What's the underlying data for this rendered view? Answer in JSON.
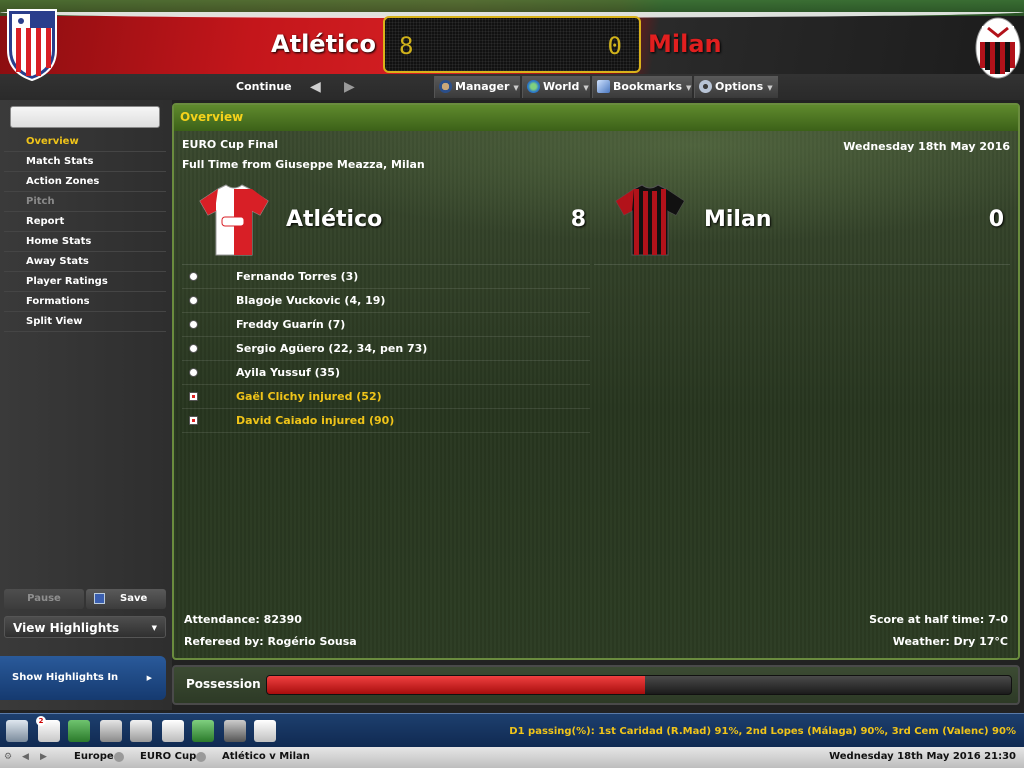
{
  "header": {
    "home_team": "Atlético",
    "away_team": "Milan",
    "scoreboard_home": "8",
    "scoreboard_away": "0"
  },
  "nav": {
    "continue": "Continue",
    "menus": [
      "Manager",
      "World",
      "Bookmarks",
      "Options"
    ]
  },
  "sidebar": {
    "search_placeholder": "",
    "items": [
      {
        "label": "Overview",
        "state": "active"
      },
      {
        "label": "Match Stats",
        "state": "normal"
      },
      {
        "label": "Action Zones",
        "state": "normal"
      },
      {
        "label": "Pitch",
        "state": "disabled"
      },
      {
        "label": "Report",
        "state": "normal"
      },
      {
        "label": "Home Stats",
        "state": "normal"
      },
      {
        "label": "Away Stats",
        "state": "normal"
      },
      {
        "label": "Player Ratings",
        "state": "normal"
      },
      {
        "label": "Formations",
        "state": "normal"
      },
      {
        "label": "Split View",
        "state": "normal"
      }
    ],
    "pause": "Pause",
    "save": "Save",
    "highlights_select": "View Highlights",
    "show_highlights": "Show Highlights In"
  },
  "overview": {
    "title": "Overview",
    "competition": "EURO Cup Final",
    "venue": "Full Time from Giuseppe Meazza, Milan",
    "date": "Wednesday 18th May 2016",
    "home": {
      "name": "Atlético",
      "score": "8",
      "shirt_primary": "#d81f26",
      "shirt_secondary": "#ffffff"
    },
    "away": {
      "name": "Milan",
      "score": "0",
      "shirt_primary": "#b2121a",
      "shirt_secondary": "#111111"
    },
    "events": [
      {
        "text": "Fernando Torres (3)",
        "type": "goal"
      },
      {
        "text": "Blagoje Vuckovic (4, 19)",
        "type": "goal"
      },
      {
        "text": "Freddy Guarín (7)",
        "type": "goal"
      },
      {
        "text": "Sergio Agüero (22, 34, pen 73)",
        "type": "goal"
      },
      {
        "text": "Ayila Yussuf (35)",
        "type": "goal"
      },
      {
        "text": "Gaël Clichy injured (52)",
        "type": "injury"
      },
      {
        "text": "David Caiado injured (90)",
        "type": "injury"
      }
    ],
    "attendance": "Attendance: 82390",
    "referee": "Refereed by: Rogério Sousa",
    "halftime": "Score at half time: 7-0",
    "weather": "Weather: Dry 17°C"
  },
  "possession": {
    "label": "Possession",
    "home_share": 0.508,
    "home_color": "#d81f26",
    "away_color": "#1c1c1c"
  },
  "taskbar": {
    "badge_count": "2",
    "ticker": "D1 passing(%): 1st Caridad (R.Mad) 91%, 2nd Lopes (Málaga) 90%, 3rd Cem (Valenc) 90%"
  },
  "statusbar": {
    "breadcrumbs": [
      "Europe",
      "EURO Cup",
      "Atlético v Milan"
    ],
    "datetime": "Wednesday 18th May 2016 21:30"
  },
  "colors": {
    "accent_yellow": "#f0c419",
    "brand_red": "#c4161b",
    "panel_green": "#5f8a2d"
  }
}
